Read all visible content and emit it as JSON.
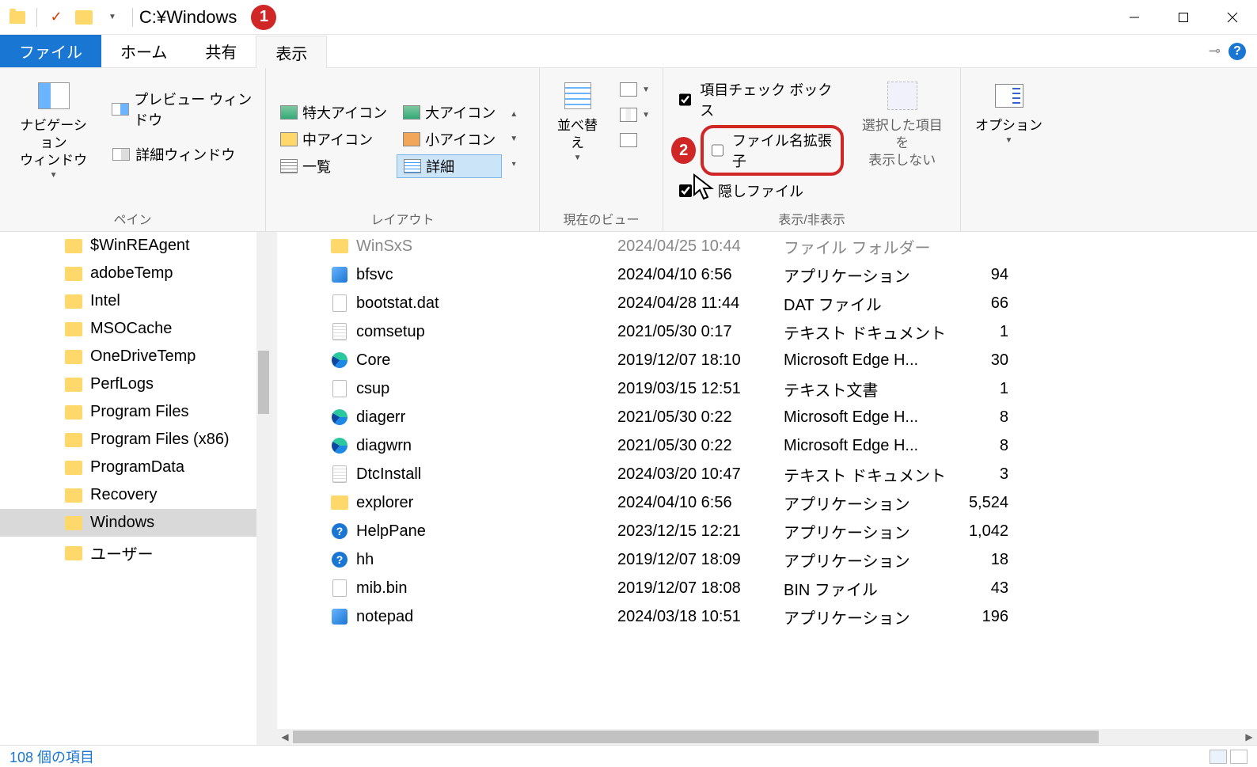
{
  "title": "C:¥Windows",
  "annotations": {
    "badge1": "1",
    "badge2": "2"
  },
  "menubar": {
    "file": "ファイル",
    "home": "ホーム",
    "share": "共有",
    "view": "表示"
  },
  "ribbon": {
    "panes": {
      "navigation": "ナビゲーション\nウィンドウ",
      "preview": "プレビュー ウィンドウ",
      "details": "詳細ウィンドウ",
      "group_label": "ペイン"
    },
    "layout": {
      "extra_large": "特大アイコン",
      "large": "大アイコン",
      "medium": "中アイコン",
      "small": "小アイコン",
      "list": "一覧",
      "details": "詳細",
      "group_label": "レイアウト"
    },
    "current_view": {
      "sort": "並べ替え",
      "group_label": "現在のビュー"
    },
    "show_hide": {
      "item_checkboxes": "項目チェック ボックス",
      "file_extensions": "ファイル名拡張子",
      "hidden_items": "隠しファイル",
      "hide_selected": "選択した項目を\n表示しない",
      "group_label": "表示/非表示"
    },
    "options": {
      "label": "オプション"
    }
  },
  "tree": [
    {
      "name": "$WinREAgent",
      "selected": false
    },
    {
      "name": "adobeTemp",
      "selected": false
    },
    {
      "name": "Intel",
      "selected": false
    },
    {
      "name": "MSOCache",
      "selected": false
    },
    {
      "name": "OneDriveTemp",
      "selected": false
    },
    {
      "name": "PerfLogs",
      "selected": false
    },
    {
      "name": "Program Files",
      "selected": false
    },
    {
      "name": "Program Files (x86)",
      "selected": false
    },
    {
      "name": "ProgramData",
      "selected": false
    },
    {
      "name": "Recovery",
      "selected": false
    },
    {
      "name": "Windows",
      "selected": true
    },
    {
      "name": "ユーザー",
      "selected": false
    }
  ],
  "files": [
    {
      "icon": "folder",
      "name": "WinSxS",
      "date": "2024/04/25 10:44",
      "type": "ファイル フォルダー",
      "size": "",
      "dim": true
    },
    {
      "icon": "exe",
      "name": "bfsvc",
      "date": "2024/04/10 6:56",
      "type": "アプリケーション",
      "size": "94"
    },
    {
      "icon": "file",
      "name": "bootstat.dat",
      "date": "2024/04/28 11:44",
      "type": "DAT ファイル",
      "size": "66"
    },
    {
      "icon": "txt",
      "name": "comsetup",
      "date": "2021/05/30 0:17",
      "type": "テキスト ドキュメント",
      "size": "1"
    },
    {
      "icon": "edge",
      "name": "Core",
      "date": "2019/12/07 18:10",
      "type": "Microsoft Edge H...",
      "size": "30"
    },
    {
      "icon": "file",
      "name": "csup",
      "date": "2019/03/15 12:51",
      "type": "テキスト文書",
      "size": "1"
    },
    {
      "icon": "edge",
      "name": "diagerr",
      "date": "2021/05/30 0:22",
      "type": "Microsoft Edge H...",
      "size": "8"
    },
    {
      "icon": "edge",
      "name": "diagwrn",
      "date": "2021/05/30 0:22",
      "type": "Microsoft Edge H...",
      "size": "8"
    },
    {
      "icon": "txt",
      "name": "DtcInstall",
      "date": "2024/03/20 10:47",
      "type": "テキスト ドキュメント",
      "size": "3"
    },
    {
      "icon": "folder",
      "name": "explorer",
      "date": "2024/04/10 6:56",
      "type": "アプリケーション",
      "size": "5,524"
    },
    {
      "icon": "help",
      "name": "HelpPane",
      "date": "2023/12/15 12:21",
      "type": "アプリケーション",
      "size": "1,042"
    },
    {
      "icon": "help",
      "name": "hh",
      "date": "2019/12/07 18:09",
      "type": "アプリケーション",
      "size": "18"
    },
    {
      "icon": "file",
      "name": "mib.bin",
      "date": "2019/12/07 18:08",
      "type": "BIN ファイル",
      "size": "43"
    },
    {
      "icon": "exe",
      "name": "notepad",
      "date": "2024/03/18 10:51",
      "type": "アプリケーション",
      "size": "196"
    }
  ],
  "status": {
    "items": "108 個の項目"
  }
}
